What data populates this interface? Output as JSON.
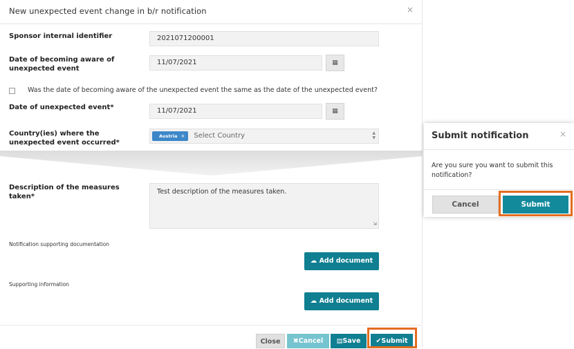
{
  "modal": {
    "title": "New unexpected event change in b/r notification",
    "close_glyph": "×",
    "sponsor_label": "Sponsor internal identifier",
    "sponsor_value": "2021071200001",
    "aware_label": "Date of becoming aware of unexpected event",
    "aware_value": "11/07/2021",
    "same_date_text": "Was the date of becoming aware of the unexpected event the same as the date of the unexpected event?",
    "event_date_label": "Date of unexpected event*",
    "event_date_value": "11/07/2021",
    "country_label": "Country(ies) where the unexpected event occurred*",
    "country_tag": "Austria",
    "country_tag_remove": "×",
    "country_placeholder": "Select Country",
    "measures_label": "Description of the measures taken*",
    "measures_value": "Test description of the measures taken.",
    "supporting_doc_label": "Notification supporting documentation",
    "add_document_1": "Add document",
    "supporting_info_label": "Supporting information",
    "add_document_2": "Add document"
  },
  "footer": {
    "close": "Close",
    "cancel": "Cancel",
    "save": "Save",
    "submit": "Submit"
  },
  "dialog": {
    "title": "Submit notification",
    "close_glyph": "×",
    "message": "Are you sure you want to submit this notification?",
    "cancel": "Cancel",
    "submit": "Submit"
  },
  "colors": {
    "teal": "#0f7f91",
    "highlight": "#e46d1f",
    "tag": "#3d87c9"
  }
}
